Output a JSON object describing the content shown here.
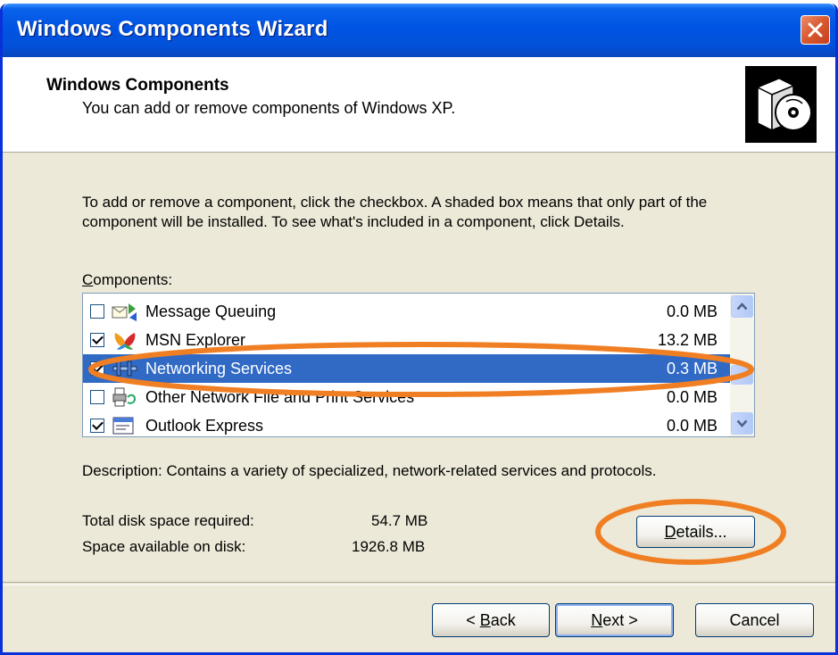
{
  "window": {
    "title": "Windows Components Wizard"
  },
  "header": {
    "title": "Windows Components",
    "subtitle": "You can add or remove components of Windows XP."
  },
  "body": {
    "instructions": "To add or remove a component, click the checkbox.  A shaded box means that only part of the component will be installed.  To see what's included in a component, click Details.",
    "components_label_accesskey": "C",
    "components_label_rest": "omponents:",
    "components": [
      {
        "name": "Message Queuing",
        "size": "0.0 MB",
        "checked": false,
        "icon": "message-queuing-icon"
      },
      {
        "name": "MSN Explorer",
        "size": "13.2 MB",
        "checked": true,
        "icon": "msn-butterfly-icon"
      },
      {
        "name": "Networking Services",
        "size": "0.3 MB",
        "checked": true,
        "selected": true,
        "icon": "network-services-icon"
      },
      {
        "name": "Other Network File and Print Services",
        "size": "0.0 MB",
        "checked": false,
        "icon": "printer-network-icon"
      },
      {
        "name": "Outlook Express",
        "size": "0.0 MB",
        "checked": true,
        "icon": "outlook-express-icon"
      }
    ],
    "description": "Description:  Contains a variety of specialized, network-related services and protocols.",
    "disk_required_label": "Total disk space required:",
    "disk_required_value": "54.7 MB",
    "disk_available_label": "Space available on disk:",
    "disk_available_value": "1926.8 MB",
    "details_accesskey": "D",
    "details_rest": "etails..."
  },
  "footer": {
    "back_prefix": "< ",
    "back_accesskey": "B",
    "back_rest": "ack",
    "next_accesskey": "N",
    "next_rest": "ext >",
    "cancel_label": "Cancel"
  },
  "colors": {
    "titlebar": "#0054e3",
    "selection": "#316ac5",
    "dialog_bg": "#ece9d8",
    "annotation": "#f07f24"
  }
}
